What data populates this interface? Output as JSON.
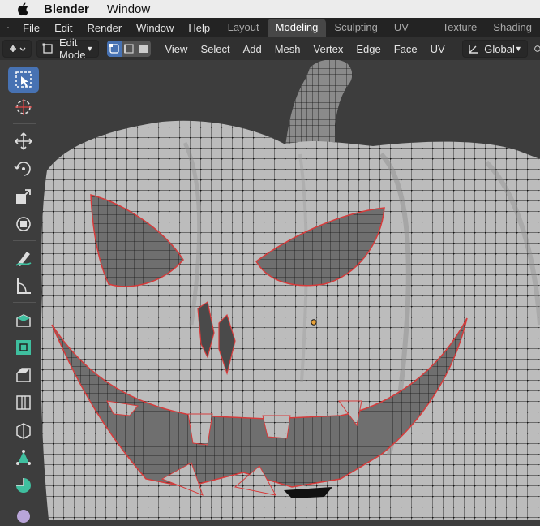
{
  "mac_menu": {
    "app_name": "Blender",
    "window_label": "Window"
  },
  "top_menu": [
    "File",
    "Edit",
    "Render",
    "Window",
    "Help"
  ],
  "workspaces": [
    "Layout",
    "Modeling",
    "Sculpting",
    "UV Editing",
    "Texture Paint",
    "Shading"
  ],
  "active_workspace": "Modeling",
  "header": {
    "mode": "Edit Mode",
    "menus": [
      "View",
      "Select",
      "Add",
      "Mesh",
      "Vertex",
      "Edge",
      "Face",
      "UV"
    ],
    "transform_orientation": "Global"
  },
  "toolbar": {
    "tools": [
      "select-box",
      "cursor",
      "move",
      "rotate",
      "scale",
      "transform",
      "annotate",
      "measure",
      "extrude-region",
      "inset-faces",
      "bevel",
      "loop-cut",
      "knife",
      "poly-build",
      "spin",
      "smooth"
    ],
    "active_tool": "select-box"
  },
  "colors": {
    "accent": "#4772b3",
    "mesh": "#bdbdbd",
    "edge": "#111111",
    "seam": "#d63b3b",
    "origin": "#e8a23a"
  }
}
